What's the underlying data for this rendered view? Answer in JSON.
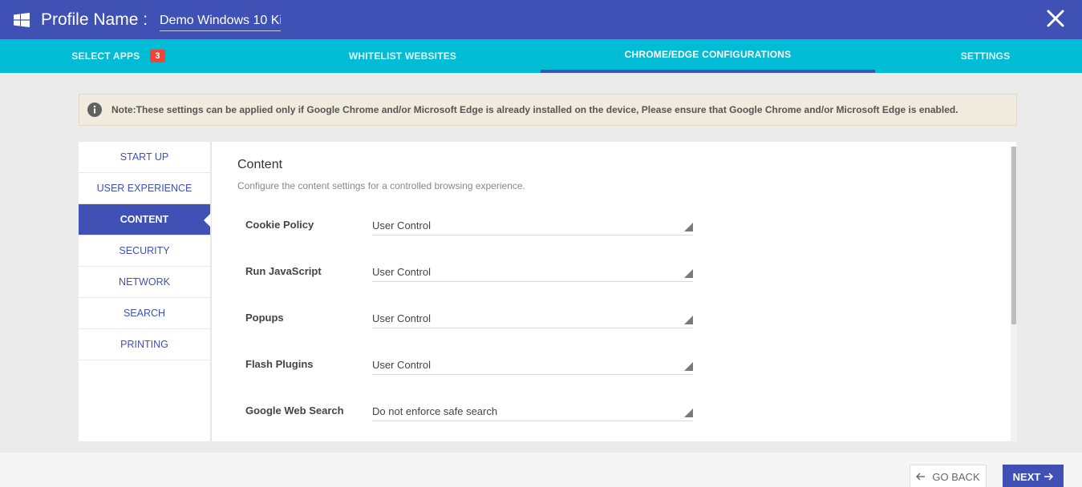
{
  "header": {
    "title": "Profile Name :",
    "profile_name": "Demo Windows 10 Ki",
    "bg_color": "#3f51b5"
  },
  "tabs": [
    {
      "label": "SELECT APPS",
      "badge": "3",
      "active": false
    },
    {
      "label": "WHITELIST WEBSITES",
      "active": false
    },
    {
      "label": "CHROME/EDGE CONFIGURATIONS",
      "active": true
    },
    {
      "label": "SETTINGS",
      "active": false
    }
  ],
  "tab_bar_color": "#00bcd4",
  "note": {
    "icon": "info-icon",
    "text": "Note:These settings can be applied only if Google Chrome and/or Microsoft Edge is already installed on the device, Please ensure that Google Chrome and/or Microsoft Edge is enabled."
  },
  "sidebar": {
    "items": [
      {
        "label": "START UP"
      },
      {
        "label": "USER EXPERIENCE"
      },
      {
        "label": "CONTENT",
        "active": true
      },
      {
        "label": "SECURITY"
      },
      {
        "label": "NETWORK"
      },
      {
        "label": "SEARCH"
      },
      {
        "label": "PRINTING"
      }
    ]
  },
  "content": {
    "title": "Content",
    "subtitle": "Configure the content settings for a controlled browsing experience.",
    "settings": [
      {
        "label": "Cookie Policy",
        "value": "User Control"
      },
      {
        "label": "Run JavaScript",
        "value": "User Control"
      },
      {
        "label": "Popups",
        "value": "User Control"
      },
      {
        "label": "Flash Plugins",
        "value": "User Control"
      },
      {
        "label": "Google Web Search",
        "value": "Do not enforce safe search"
      }
    ]
  },
  "footer": {
    "back_label": "GO BACK",
    "next_label": "NEXT"
  }
}
